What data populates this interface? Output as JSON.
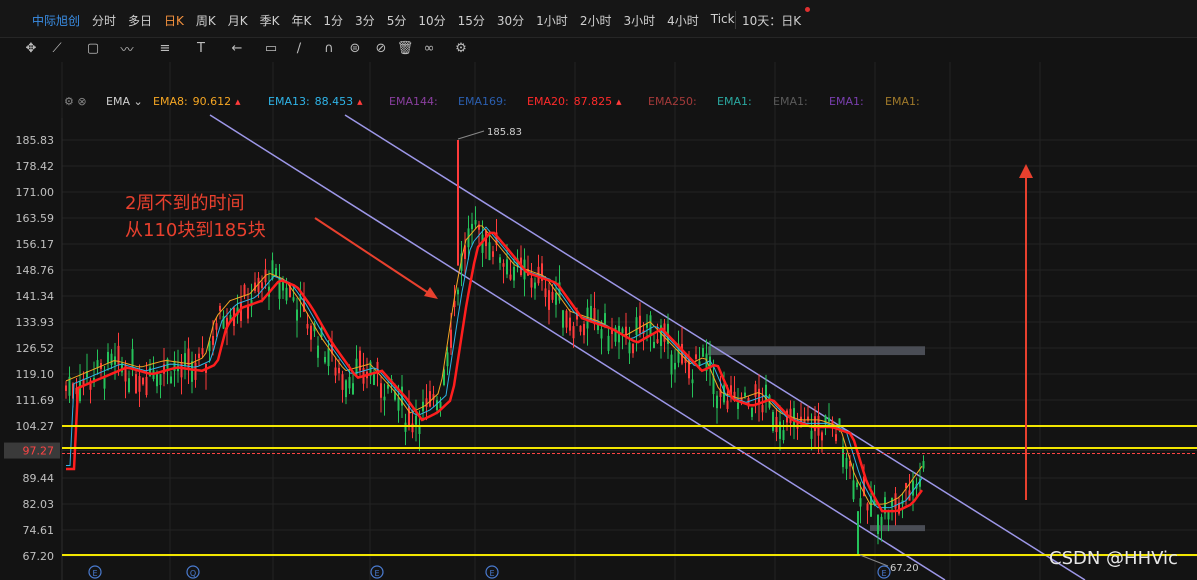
{
  "topbar": {
    "stock_name": "中际旭创",
    "periods": [
      "分时",
      "多日",
      "日K",
      "周K",
      "月K",
      "季K",
      "年K",
      "1分",
      "3分",
      "5分",
      "10分",
      "15分",
      "30分",
      "1小时",
      "2小时",
      "3小时",
      "4小时",
      "Tick"
    ],
    "active_period": "日K",
    "range_label": "10天：日K",
    "active_color": "#f5923e"
  },
  "toolbar": {
    "tools": [
      "crosshair-icon",
      "trendline-icon",
      "rectangle-icon",
      "wave-icon",
      "fib-icon",
      "text-icon",
      "arrow-icon",
      "comment-icon",
      "brush-icon",
      "magnet-icon",
      "lock-icon",
      "hide-icon",
      "trash-icon",
      "link-icon",
      "settings-icon"
    ]
  },
  "ema_legend": {
    "indicator": "EMA",
    "items": [
      {
        "label": "EMA8:",
        "value": "90.612",
        "color": "#f5a623",
        "arrow": "▲"
      },
      {
        "label": "EMA13:",
        "value": "88.453",
        "color": "#2fb4e8",
        "arrow": "▲"
      },
      {
        "label": "EMA144:",
        "value": "",
        "color": "#8a3fa0",
        "arrow": ""
      },
      {
        "label": "EMA169:",
        "value": "",
        "color": "#2b5fb0",
        "arrow": ""
      },
      {
        "label": "EMA20:",
        "value": "87.825",
        "color": "#ff2b2b",
        "arrow": "▲"
      },
      {
        "label": "EMA250:",
        "value": "",
        "color": "#a53a3a",
        "arrow": ""
      },
      {
        "label": "EMA1:",
        "value": "",
        "color": "#2aa8a0",
        "arrow": ""
      },
      {
        "label": "EMA1:",
        "value": "",
        "color": "#5a5a5a",
        "arrow": ""
      },
      {
        "label": "EMA1:",
        "value": "",
        "color": "#7a3fb0",
        "arrow": ""
      },
      {
        "label": "EMA1:",
        "value": "",
        "color": "#a07a2a",
        "arrow": ""
      }
    ]
  },
  "annotation": {
    "line1": "2周不到的时间",
    "line2": "从110块到185块"
  },
  "watermark": "CSDN @HHVic",
  "chart_data": {
    "type": "candlestick",
    "title": "中际旭创 日K",
    "y_ticks": [
      "185.83",
      "178.42",
      "171.00",
      "163.59",
      "156.17",
      "148.76",
      "141.34",
      "133.93",
      "126.52",
      "119.10",
      "111.69",
      "104.27",
      "97.27",
      "89.44",
      "82.03",
      "74.61",
      "67.20"
    ],
    "y_range": [
      67.2,
      185.83
    ],
    "current_price": "97.27",
    "high_label": "185.83",
    "low_label": "67.20",
    "horizontal_levels": [
      104.27,
      98.0,
      68.0
    ],
    "resistance_zones": [
      [
        124.5,
        127.0
      ],
      [
        74.3,
        76.0
      ]
    ],
    "ema_last": {
      "EMA8": 90.612,
      "EMA13": 88.453,
      "EMA20": 87.825
    },
    "colors": {
      "up": "#ff3b3b",
      "down": "#25c25a",
      "level": "#f2e600",
      "channel": "#9d97e8",
      "price_label_bg": "#3a3a3a",
      "zone": "#4a4d55"
    },
    "markers": [
      "E",
      "Q",
      "E",
      "E",
      "E"
    ]
  }
}
